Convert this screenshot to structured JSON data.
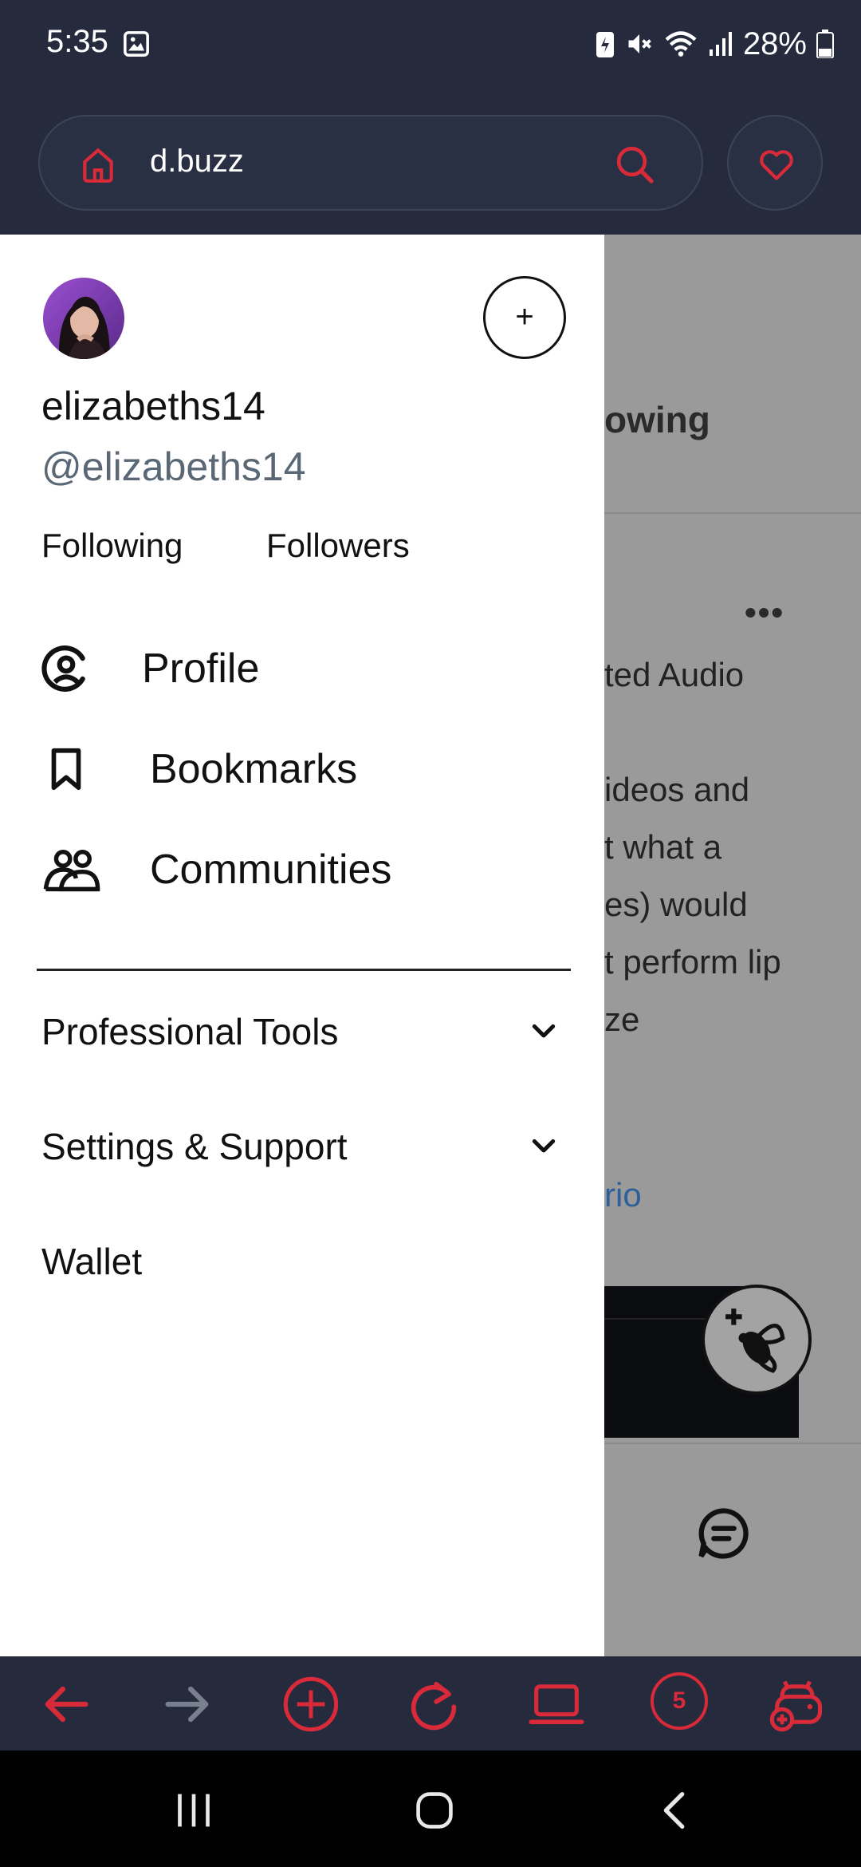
{
  "status_bar": {
    "time": "5:35",
    "battery": "28%"
  },
  "browser": {
    "url": "d.buzz"
  },
  "drawer": {
    "username": "elizabeths14",
    "handle": "@elizabeths14",
    "following_label": "Following",
    "followers_label": "Followers",
    "menu": {
      "profile": "Profile",
      "bookmarks": "Bookmarks",
      "communities": "Communities"
    },
    "sections": {
      "professional_tools": "Professional Tools",
      "settings_support": "Settings & Support",
      "wallet": "Wallet"
    },
    "add_button": "+"
  },
  "background_page": {
    "title_fragment": "owing",
    "lines": [
      "ted Audio",
      "ideos and",
      "t what a",
      "es) would",
      "t perform lip",
      "ze"
    ],
    "link_fragment": "rio",
    "more_menu": "•••"
  },
  "toolbar": {
    "tab_count": "5"
  },
  "colors": {
    "chrome_bg": "#252b3d",
    "accent": "#d92a3a",
    "drawer_bg": "#ffffff",
    "overlay": "#9a9a9a"
  }
}
